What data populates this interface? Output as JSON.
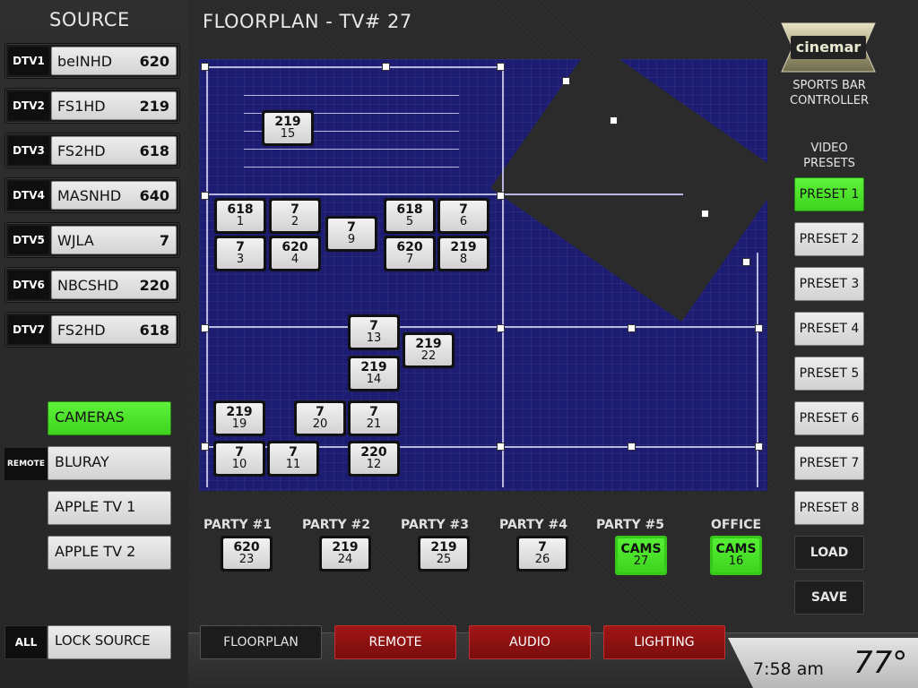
{
  "source_panel": {
    "title": "SOURCE",
    "dtv": [
      {
        "tag": "DTV1",
        "name": "beINHD",
        "channel": "620"
      },
      {
        "tag": "DTV2",
        "name": "FS1HD",
        "channel": "219"
      },
      {
        "tag": "DTV3",
        "name": "FS2HD",
        "channel": "618"
      },
      {
        "tag": "DTV4",
        "name": "MASNHD",
        "channel": "640"
      },
      {
        "tag": "DTV5",
        "name": "WJLA",
        "channel": "7"
      },
      {
        "tag": "DTV6",
        "name": "NBCSHD",
        "channel": "220"
      },
      {
        "tag": "DTV7",
        "name": "FS2HD",
        "channel": "618"
      }
    ],
    "cameras": "CAMERAS",
    "remote_tag": "REMOTE",
    "bluray": "BLURAY",
    "apple_tv_1": "APPLE TV 1",
    "apple_tv_2": "APPLE TV 2",
    "all_tag": "ALL",
    "lock_source": "LOCK SOURCE"
  },
  "header": {
    "title": "FLOORPLAN  -  TV# 27"
  },
  "tvs": [
    {
      "channel": "219",
      "number": "15"
    },
    {
      "channel": "618",
      "number": "1"
    },
    {
      "channel": "7",
      "number": "2"
    },
    {
      "channel": "7",
      "number": "9"
    },
    {
      "channel": "618",
      "number": "5"
    },
    {
      "channel": "7",
      "number": "6"
    },
    {
      "channel": "7",
      "number": "3"
    },
    {
      "channel": "620",
      "number": "4"
    },
    {
      "channel": "620",
      "number": "7"
    },
    {
      "channel": "219",
      "number": "8"
    },
    {
      "channel": "7",
      "number": "13"
    },
    {
      "channel": "219",
      "number": "22"
    },
    {
      "channel": "219",
      "number": "14"
    },
    {
      "channel": "219",
      "number": "19"
    },
    {
      "channel": "7",
      "number": "20"
    },
    {
      "channel": "7",
      "number": "21"
    },
    {
      "channel": "7",
      "number": "10"
    },
    {
      "channel": "7",
      "number": "11"
    },
    {
      "channel": "220",
      "number": "12"
    }
  ],
  "parties": [
    {
      "label": "PARTY #1",
      "channel": "620",
      "number": "23",
      "active": false
    },
    {
      "label": "PARTY #2",
      "channel": "219",
      "number": "24",
      "active": false
    },
    {
      "label": "PARTY #3",
      "channel": "219",
      "number": "25",
      "active": false
    },
    {
      "label": "PARTY #4",
      "channel": "7",
      "number": "26",
      "active": false
    },
    {
      "label": "PARTY #5",
      "channel": "CAMS",
      "number": "27",
      "active": true
    },
    {
      "label": "OFFICE",
      "channel": "CAMS",
      "number": "16",
      "active": true
    }
  ],
  "brand": {
    "logo_text": "cinemar",
    "subtitle_1": "SPORTS BAR",
    "subtitle_2": "CONTROLLER"
  },
  "video_presets": {
    "heading_1": "VIDEO",
    "heading_2": "PRESETS",
    "presets": [
      "PRESET 1",
      "PRESET 2",
      "PRESET 3",
      "PRESET 4",
      "PRESET 5",
      "PRESET 6",
      "PRESET 7",
      "PRESET 8"
    ],
    "active_index": 0,
    "load": "LOAD",
    "save": "SAVE"
  },
  "tabs": [
    {
      "label": "FLOORPLAN",
      "style": "dark"
    },
    {
      "label": "REMOTE",
      "style": "red"
    },
    {
      "label": "AUDIO",
      "style": "red"
    },
    {
      "label": "LIGHTING",
      "style": "red"
    }
  ],
  "status": {
    "time": "7:58 am",
    "temperature": "77°"
  },
  "colors": {
    "active_green": "#4be02a",
    "tab_red": "#8c1010",
    "floorplan_blue": "#1c1c72"
  }
}
